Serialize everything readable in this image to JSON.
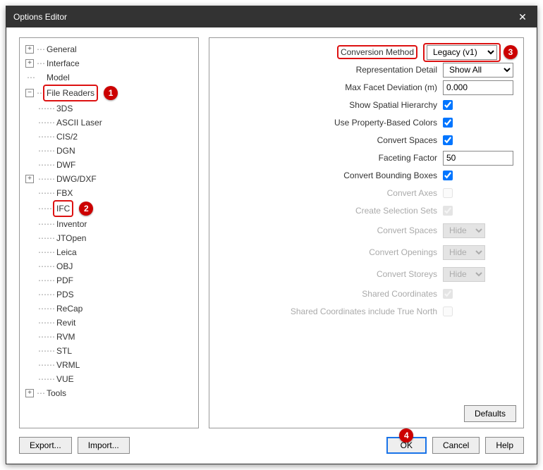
{
  "window": {
    "title": "Options Editor"
  },
  "callouts": {
    "c1": "1",
    "c2": "2",
    "c3": "3",
    "c4": "4"
  },
  "tree": {
    "general": "General",
    "interface": "Interface",
    "model": "Model",
    "fileReaders": "File Readers",
    "readers": {
      "r0": "3DS",
      "r1": "ASCII Laser",
      "r2": "CIS/2",
      "r3": "DGN",
      "r4": "DWF",
      "r5": "DWG/DXF",
      "r6": "FBX",
      "r7": "IFC",
      "r8": "Inventor",
      "r9": "JTOpen",
      "r10": "Leica",
      "r11": "OBJ",
      "r12": "PDF",
      "r13": "PDS",
      "r14": "ReCap",
      "r15": "Revit",
      "r16": "RVM",
      "r17": "STL",
      "r18": "VRML",
      "r19": "VUE"
    },
    "tools": "Tools"
  },
  "form": {
    "conversionMethod": {
      "label": "Conversion Method",
      "value": "Legacy (v1)"
    },
    "representationDetail": {
      "label": "Representation Detail",
      "value": "Show All"
    },
    "maxFacet": {
      "label": "Max Facet Deviation (m)",
      "value": "0.000"
    },
    "showSpatial": {
      "label": "Show Spatial Hierarchy"
    },
    "usePropColors": {
      "label": "Use Property-Based Colors"
    },
    "convertSpaces": {
      "label": "Convert Spaces"
    },
    "facetingFactor": {
      "label": "Faceting Factor",
      "value": "50"
    },
    "convertBounding": {
      "label": "Convert Bounding Boxes"
    },
    "convertAxes": {
      "label": "Convert Axes"
    },
    "createSelSets": {
      "label": "Create Selection Sets"
    },
    "convertSpaces2": {
      "label": "Convert Spaces",
      "value": "Hide"
    },
    "convertOpenings": {
      "label": "Convert Openings",
      "value": "Hide"
    },
    "convertStoreys": {
      "label": "Convert Storeys",
      "value": "Hide"
    },
    "sharedCoords": {
      "label": "Shared Coordinates"
    },
    "sharedCoordsTN": {
      "label": "Shared Coordinates include True North"
    }
  },
  "buttons": {
    "defaults": "Defaults",
    "export": "Export...",
    "import": "Import...",
    "ok": "OK",
    "cancel": "Cancel",
    "help": "Help"
  },
  "glyphs": {
    "plus": "+",
    "minus": "−",
    "dots1": "⋯",
    "dots2": "⋯⋯"
  }
}
